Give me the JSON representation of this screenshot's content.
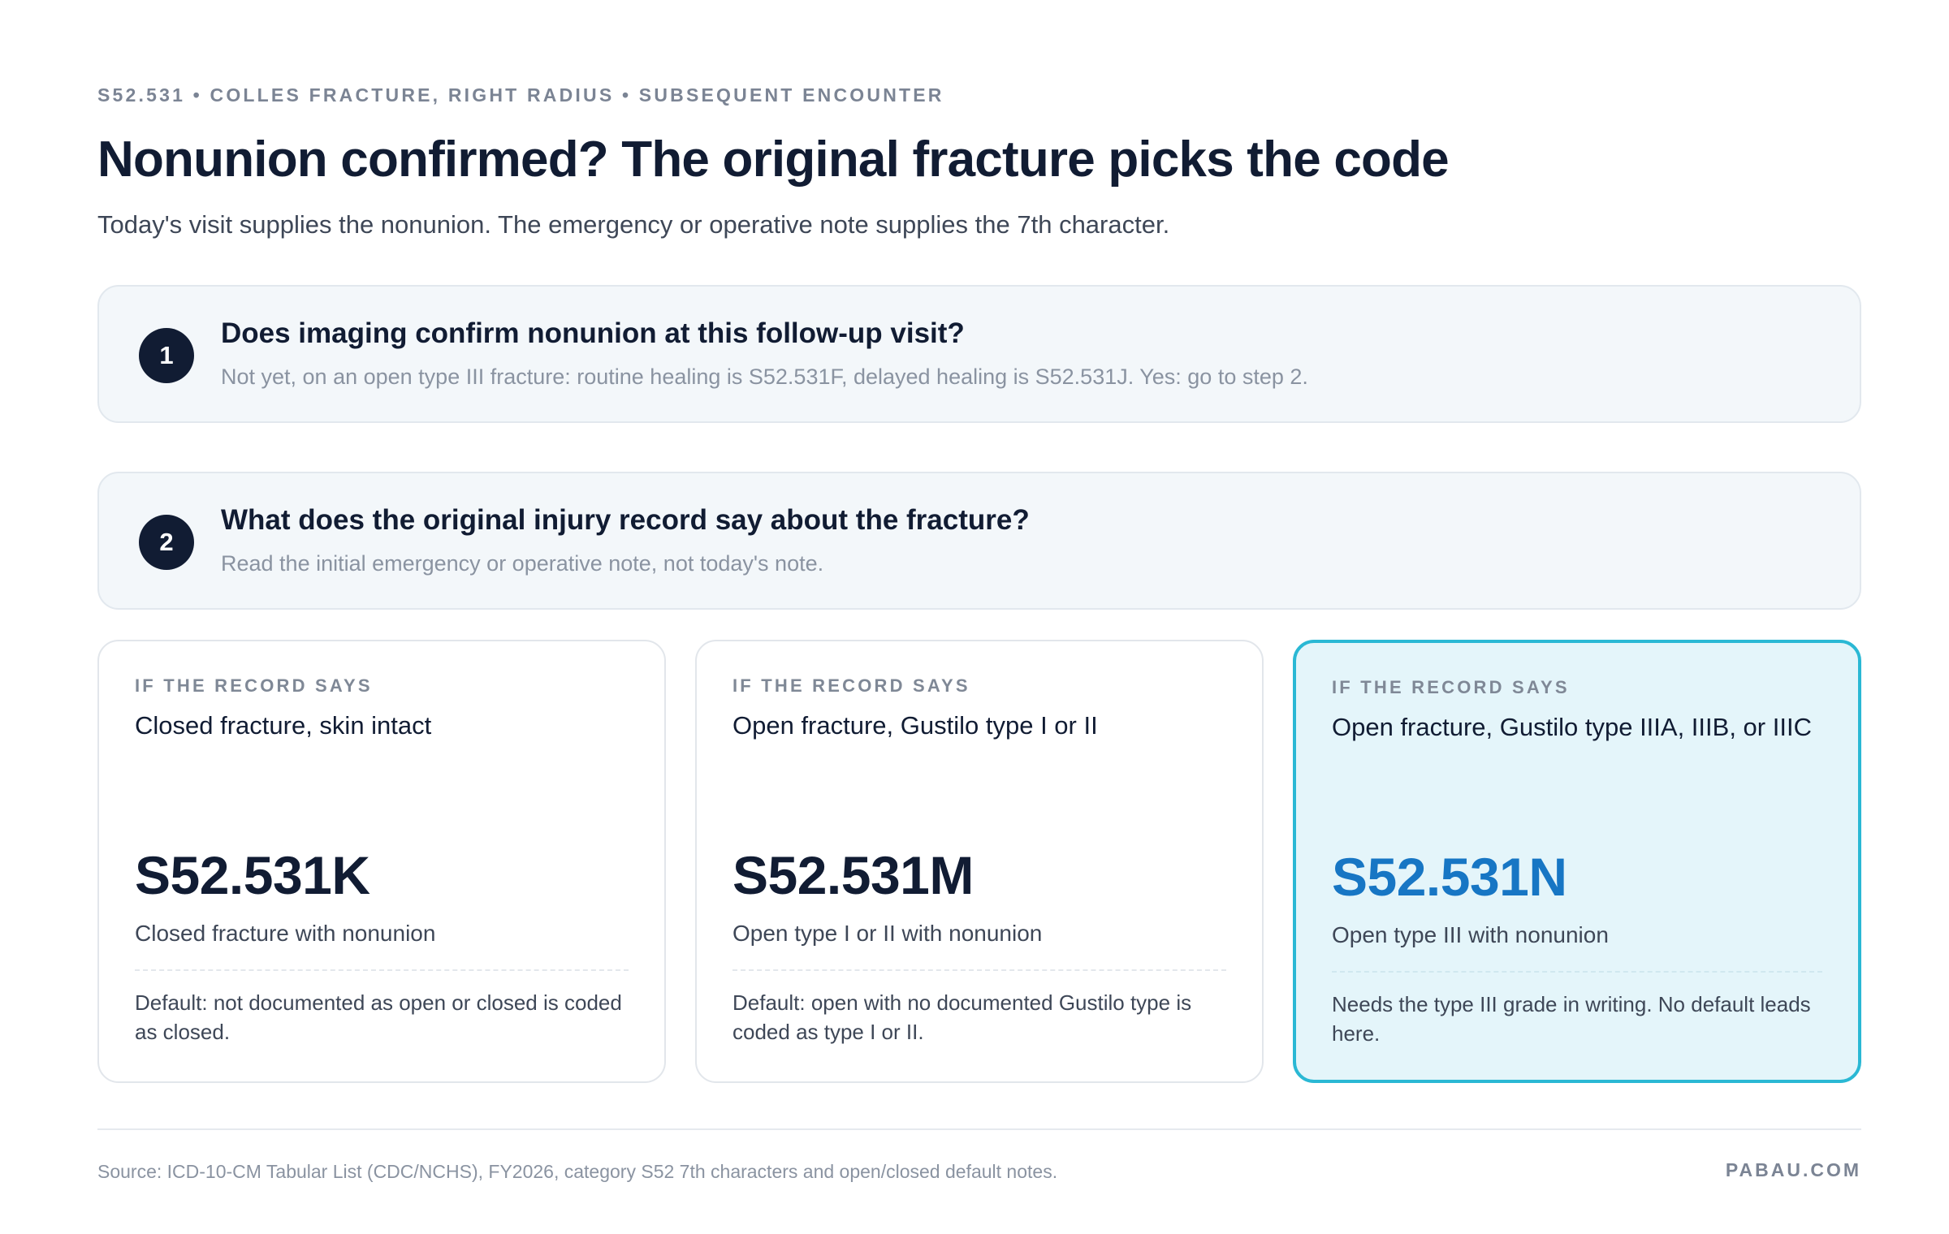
{
  "header": {
    "eyebrow": "S52.531 • COLLES FRACTURE, RIGHT RADIUS • SUBSEQUENT ENCOUNTER",
    "title": "Nonunion confirmed? The original fracture picks the code",
    "subtitle": "Today's visit supplies the nonunion. The emergency or operative note supplies the 7th character."
  },
  "steps": [
    {
      "number": "1",
      "question": "Does imaging confirm nonunion at this follow-up visit?",
      "hint": "Not yet, on an open type III fracture: routine healing is S52.531F, delayed healing is S52.531J. Yes: go to step 2."
    },
    {
      "number": "2",
      "question": "What does the original injury record say about the fracture?",
      "hint": "Read the initial emergency or operative note, not today's note."
    }
  ],
  "cards": [
    {
      "label": "IF THE RECORD SAYS",
      "condition": "Closed fracture, skin intact",
      "code": "S52.531K",
      "description": "Closed fracture with nonunion",
      "note": "Default: not documented as open or closed is coded as closed.",
      "highlighted": false
    },
    {
      "label": "IF THE RECORD SAYS",
      "condition": "Open fracture, Gustilo type I or II",
      "code": "S52.531M",
      "description": "Open type I or II with nonunion",
      "note": "Default: open with no documented Gustilo type is coded as type I or II.",
      "highlighted": false
    },
    {
      "label": "IF THE RECORD SAYS",
      "condition": "Open fracture, Gustilo type IIIA, IIIB, or IIIC",
      "code": "S52.531N",
      "description": "Open type III with nonunion",
      "note": "Needs the type III grade in writing. No default leads here.",
      "highlighted": true
    }
  ],
  "footer": {
    "source": "Source: ICD-10-CM Tabular List (CDC/NCHS), FY2026, category S52 7th characters and open/closed default notes.",
    "brand": "PABAU.COM"
  },
  "colors": {
    "navy": "#111c33",
    "accent_blue": "#1776c4",
    "highlight_border": "#2ab8d4",
    "highlight_fill": "#e4f5fa",
    "step_fill": "#f3f7fa"
  }
}
